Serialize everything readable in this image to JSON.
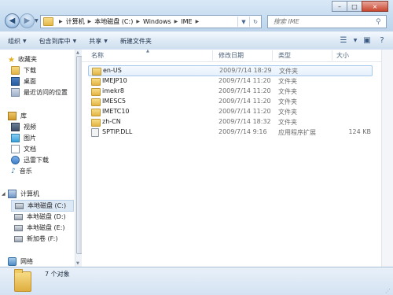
{
  "window": {
    "caption_buttons": [
      "–",
      "□",
      "×"
    ]
  },
  "address": {
    "crumbs": [
      "计算机",
      "本地磁盘 (C:)",
      "Windows",
      "IME"
    ],
    "search_placeholder": "搜索 IME"
  },
  "toolbar": {
    "organize": "组织",
    "include": "包含到库中",
    "share": "共享",
    "new_folder": "新建文件夹"
  },
  "nav": {
    "favorites": "收藏夹",
    "downloads": "下载",
    "desktop": "桌面",
    "recent": "最近访问的位置",
    "libraries": "库",
    "videos": "视频",
    "pictures": "图片",
    "documents": "文档",
    "thunder": "迅雷下载",
    "music": "音乐",
    "computer": "计算机",
    "drive_c": "本地磁盘 (C:)",
    "drive_d": "本地磁盘 (D:)",
    "drive_e": "本地磁盘 (E:)",
    "drive_f": "新加卷 (F:)",
    "network": "网络"
  },
  "columns": {
    "name": "名称",
    "modified": "修改日期",
    "type": "类型",
    "size": "大小"
  },
  "files": [
    {
      "name": "en-US",
      "date": "2009/7/14 18:29",
      "type": "文件夹",
      "size": ""
    },
    {
      "name": "IMEJP10",
      "date": "2009/7/14 11:20",
      "type": "文件夹",
      "size": ""
    },
    {
      "name": "imekr8",
      "date": "2009/7/14 11:20",
      "type": "文件夹",
      "size": ""
    },
    {
      "name": "IMESC5",
      "date": "2009/7/14 11:20",
      "type": "文件夹",
      "size": ""
    },
    {
      "name": "IMETC10",
      "date": "2009/7/14 11:20",
      "type": "文件夹",
      "size": ""
    },
    {
      "name": "zh-CN",
      "date": "2009/7/14 18:32",
      "type": "文件夹",
      "size": ""
    },
    {
      "name": "SPTIP.DLL",
      "date": "2009/7/14 9:16",
      "type": "应用程序扩展",
      "size": "124 KB"
    }
  ],
  "status": {
    "count": "7 个对象"
  }
}
